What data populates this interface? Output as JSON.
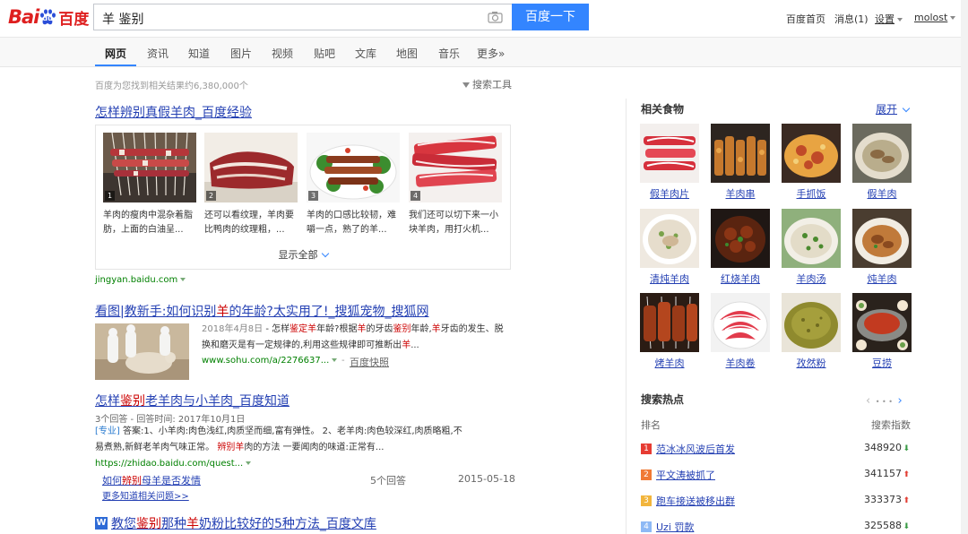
{
  "header": {
    "logo_bai": "Bai",
    "logo_du": "du",
    "logo_cn": "百度",
    "query": "羊 鉴别",
    "search_button": "百度一下",
    "nav": {
      "home": "百度首页",
      "messages": "消息(1)",
      "settings": "设置",
      "user": "molost"
    }
  },
  "tabs": [
    "网页",
    "资讯",
    "知道",
    "图片",
    "视频",
    "贴吧",
    "文库",
    "地图",
    "音乐",
    "更多»"
  ],
  "results_count": "百度为您找到相关结果约6,380,000个",
  "search_tools": "搜索工具",
  "result1": {
    "title": "怎样辨别真假羊肉_百度经验",
    "items": [
      {
        "num": "1",
        "line1": "羊肉的瘦肉中混杂着脂",
        "line2": "肪，上面的白油呈..."
      },
      {
        "num": "2",
        "line1": "还可以看纹理，羊肉要",
        "line2": "比鸭肉的纹理粗，..."
      },
      {
        "num": "3",
        "line1": "羊肉的口感比较韧，难",
        "line2": "嚼一点，熟了的羊..."
      },
      {
        "num": "4",
        "line1": "我们还可以切下来一小",
        "line2": "块羊肉，用打火机..."
      }
    ],
    "show_all": "显示全部",
    "url": "jingyan.baidu.com"
  },
  "result2": {
    "title_a": "看图|教新手:如何识别",
    "title_b": "羊",
    "title_c": "的年龄?太实用了!_搜狐宠物_搜狐网",
    "date": "2018年4月8日",
    "snip1_a": " - 怎样",
    "snip1_b": "鉴定羊",
    "snip1_c": "年龄?根据",
    "snip1_d": "羊",
    "snip1_e": "的牙齿",
    "snip1_f": "鉴别",
    "snip1_g": "年龄,",
    "snip1_h": "羊",
    "snip1_i": "牙齿的发",
    "snip2_a": "生、脱换和磨灭是有一定规律的,利用这些规律即可推断出",
    "snip2_b": "羊",
    "snip2_c": "...",
    "url": "www.sohu.com/a/2276637...",
    "cache": "百度快照"
  },
  "result3": {
    "title_a": "怎样",
    "title_b": "鉴别",
    "title_c": "老羊肉与小羊肉_百度知道",
    "meta": "3个回答 - 回答时间: 2017年10月1日",
    "pro": "[专业]",
    "snip1": " 答案:1、小羊肉:肉色浅红,肉质坚而细,富有弹性。 2、老羊肉:肉色较深红,肉质略粗,不",
    "snip2_a": "易煮熟,新鲜老羊肉气味正常。 ",
    "snip2_b": "辨别羊",
    "snip2_c": "肉的方法 一要闻肉的味道:正常有...",
    "url": "https://zhidao.baidu.com/quest...",
    "sub_a": "如何",
    "sub_b": "辨别",
    "sub_c": "母羊是否发情",
    "sub_answers": "5个回答",
    "sub_date": "2015-05-18",
    "more": "更多知道相关问题>>"
  },
  "result4": {
    "title_a": "教您",
    "title_b": "鉴别",
    "title_c": "那种",
    "title_d": "羊",
    "title_e": "奶粉比较好的5种方法_百度文库"
  },
  "sidebar": {
    "foods_title": "相关食物",
    "expand": "展开",
    "foods": [
      "假羊肉片",
      "羊肉串",
      "手抓饭",
      "假羊肉",
      "清炖羊肉",
      "红烧羊肉",
      "羊肉汤",
      "炖羊肉",
      "烤羊肉",
      "羊肉卷",
      "孜然粉",
      "豆捞"
    ],
    "hot_title": "搜索热点",
    "hot_rank_label": "排名",
    "hot_index_label": "搜索指数",
    "hot": [
      {
        "rank": "1",
        "term": "范冰冰风波后首发",
        "value": "348920",
        "trend": "down"
      },
      {
        "rank": "2",
        "term": "平文涛被抓了",
        "value": "341157",
        "trend": "up"
      },
      {
        "rank": "3",
        "term": "跑车接送被移出群",
        "value": "333373",
        "trend": "up"
      },
      {
        "rank": "4",
        "term": "Uzi 罚款",
        "value": "325588",
        "trend": "down"
      }
    ]
  },
  "colors": {
    "brand_blue": "#3385ff",
    "link_blue": "#2440b3",
    "highlight_red": "#cc0000",
    "rank1": "#e63c33",
    "rank2": "#f07a35",
    "rank3": "#f2b53c",
    "rank4": "#8eb9f5"
  }
}
